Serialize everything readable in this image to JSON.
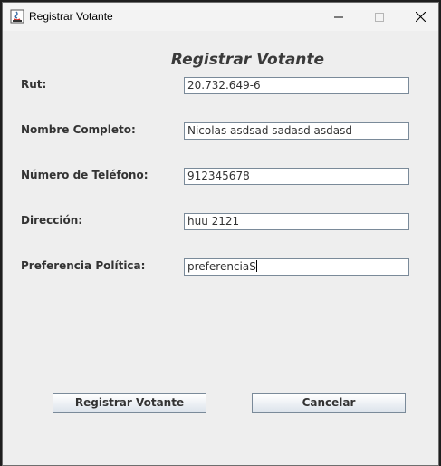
{
  "window": {
    "title": "Registrar Votante"
  },
  "form": {
    "title": "Registrar Votante",
    "fields": [
      {
        "label": "Rut:",
        "value": "20.732.649-6"
      },
      {
        "label": "Nombre Completo:",
        "value": "Nicolas asdsad sadasd asdasd"
      },
      {
        "label": "Número de Teléfono:",
        "value": "912345678"
      },
      {
        "label": "Dirección:",
        "value": "huu 2121"
      },
      {
        "label": "Preferencia Política:",
        "value": "preferenciaS"
      }
    ]
  },
  "buttons": {
    "register": "Registrar Votante",
    "cancel": "Cancelar"
  },
  "icons": {
    "app": "java-icon",
    "minimize": "minimize-icon",
    "maximize": "maximize-icon",
    "close": "close-icon"
  }
}
